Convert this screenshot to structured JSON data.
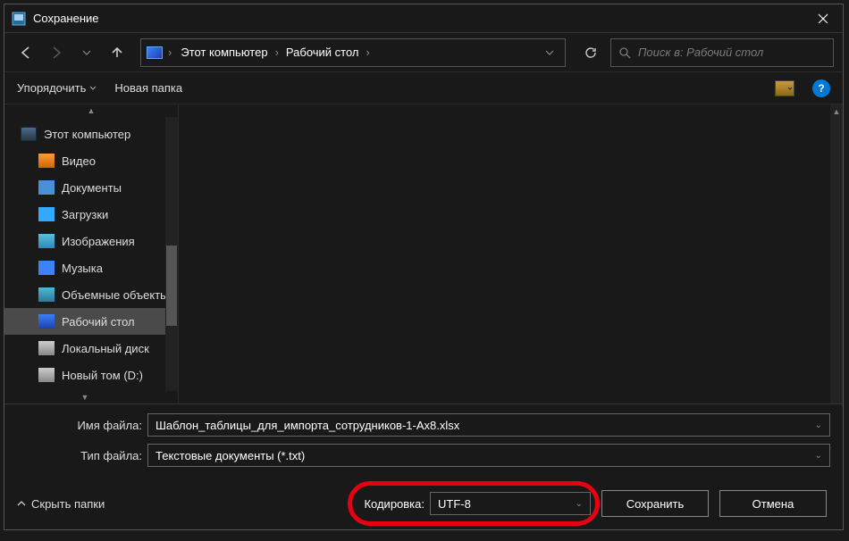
{
  "title": "Сохранение",
  "breadcrumbs": {
    "b0": "Этот компьютер",
    "b1": "Рабочий стол"
  },
  "search": {
    "placeholder": "Поиск в: Рабочий стол"
  },
  "toolbar": {
    "organize": "Упорядочить",
    "newFolder": "Новая папка"
  },
  "sidebar": {
    "computer": "Этот компьютер",
    "video": "Видео",
    "docs": "Документы",
    "downloads": "Загрузки",
    "images": "Изображения",
    "music": "Музыка",
    "objects3d": "Объемные объекты",
    "desktop": "Рабочий стол",
    "localdisk": "Локальный диск",
    "newvol": "Новый том (D:)"
  },
  "form": {
    "nameLabel": "Имя файла:",
    "nameValue": "Шаблон_таблицы_для_импорта_сотрудников-1-Ax8.xlsx",
    "typeLabel": "Тип файла:",
    "typeValue": "Текстовые документы (*.txt)"
  },
  "footer": {
    "hide": "Скрыть папки",
    "encodingLabel": "Кодировка:",
    "encodingValue": "UTF-8",
    "save": "Сохранить",
    "cancel": "Отмена"
  }
}
